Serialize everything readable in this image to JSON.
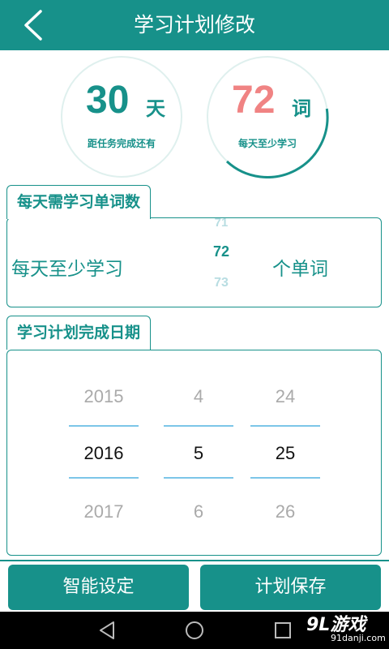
{
  "header": {
    "title": "学习计划修改"
  },
  "stats": {
    "days": {
      "value": "30",
      "unit": "天",
      "caption": "距任务完成还有",
      "color": "#17918a"
    },
    "words": {
      "value": "72",
      "unit": "词",
      "caption": "每天至少学习",
      "color": "#f08383"
    }
  },
  "words_section": {
    "title": "每天需学习单词数",
    "prefix": "每天至少学习",
    "suffix": "个单词",
    "picker": {
      "prev": "71",
      "selected": "72",
      "next": "73"
    }
  },
  "date_section": {
    "title": "学习计划完成日期",
    "year": {
      "prev": "2015",
      "selected": "2016",
      "next": "2017"
    },
    "month": {
      "prev": "4",
      "selected": "5",
      "next": "6"
    },
    "day": {
      "prev": "24",
      "selected": "25",
      "next": "26"
    }
  },
  "buttons": {
    "smart": "智能设定",
    "save": "计划保存"
  },
  "watermark": {
    "main": "9L游戏",
    "sub": "91danji.com"
  },
  "colors": {
    "accent": "#17918a",
    "highlight": "#f08383",
    "divider": "#7cc6e8"
  }
}
